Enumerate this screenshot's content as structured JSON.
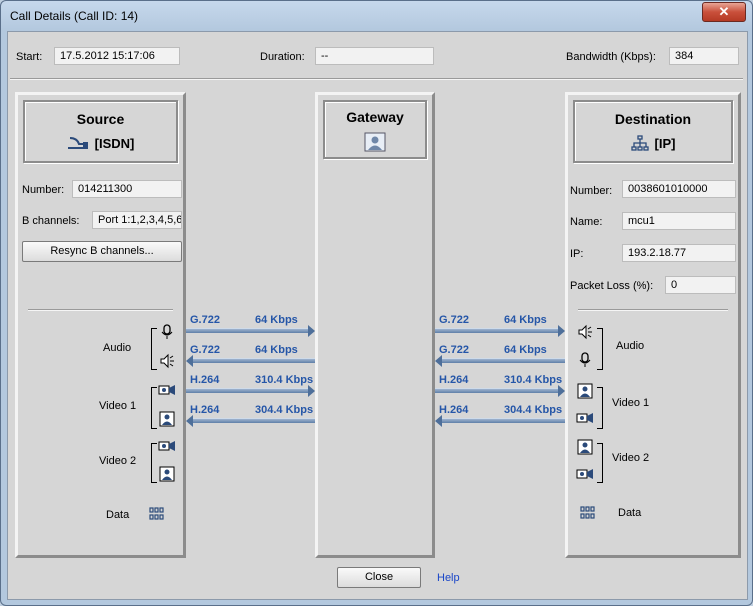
{
  "window": {
    "title": "Call Details  (Call ID: 14)",
    "close_glyph": "✕"
  },
  "summary": {
    "start_label": "Start:",
    "start_value": "17.5.2012 15:17:06",
    "duration_label": "Duration:",
    "duration_value": "--",
    "bandwidth_label": "Bandwidth (Kbps):",
    "bandwidth_value": "384"
  },
  "source": {
    "title": "Source",
    "type": "[ISDN]",
    "number_label": "Number:",
    "number_value": "014211300",
    "bchannels_label": "B channels:",
    "bchannels_value": "Port 1:1,2,3,4,5,6",
    "resync_label": "Resync B channels...",
    "media": {
      "audio": "Audio",
      "video1": "Video 1",
      "video2": "Video 2",
      "data": "Data"
    }
  },
  "gateway": {
    "title": "Gateway"
  },
  "destination": {
    "title": "Destination",
    "type": "[IP]",
    "number_label": "Number:",
    "number_value": "0038601010000",
    "name_label": "Name:",
    "name_value": "mcu1",
    "ip_label": "IP:",
    "ip_value": "193.2.18.77",
    "packet_loss_label": "Packet Loss (%):",
    "packet_loss_value": "0",
    "media": {
      "audio": "Audio",
      "video1": "Video 1",
      "video2": "Video 2",
      "data": "Data"
    }
  },
  "streams": {
    "left": [
      {
        "codec": "G.722",
        "rate": "64 Kbps",
        "direction": "right"
      },
      {
        "codec": "G.722",
        "rate": "64 Kbps",
        "direction": "left"
      },
      {
        "codec": "H.264",
        "rate": "310.4 Kbps",
        "direction": "right"
      },
      {
        "codec": "H.264",
        "rate": "304.4 Kbps",
        "direction": "left"
      }
    ],
    "right": [
      {
        "codec": "G.722",
        "rate": "64 Kbps",
        "direction": "right"
      },
      {
        "codec": "G.722",
        "rate": "64 Kbps",
        "direction": "left"
      },
      {
        "codec": "H.264",
        "rate": "310.4 Kbps",
        "direction": "right"
      },
      {
        "codec": "H.264",
        "rate": "304.4 Kbps",
        "direction": "left"
      }
    ]
  },
  "footer": {
    "close_label": "Close",
    "help_label": "Help"
  },
  "icons": {
    "isdn": "isdn-plug-icon",
    "ip": "network-icon",
    "gateway": "gateway-user-icon",
    "mic": "microphone-icon",
    "speaker": "speaker-icon",
    "camera": "camera-icon",
    "monitor": "monitor-user-icon",
    "data": "data-grid-icon"
  },
  "colors": {
    "codec_text": "#2556a8",
    "arrow": "#5f7fa8",
    "link": "#1a46c8"
  }
}
